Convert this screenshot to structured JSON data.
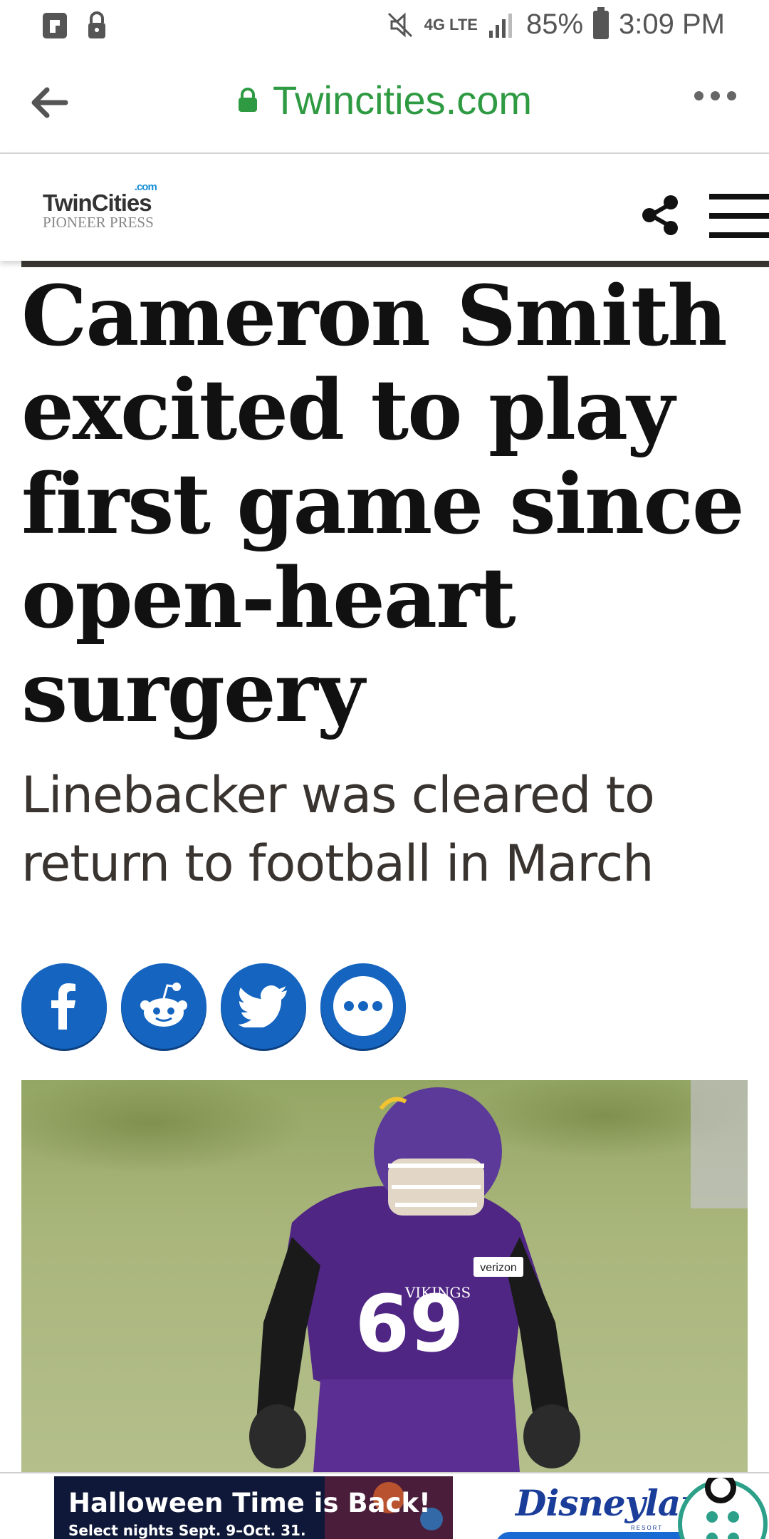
{
  "status_bar": {
    "network": "4G LTE",
    "battery": "85%",
    "time": "3:09 PM"
  },
  "browser": {
    "url": "Twincities.com"
  },
  "site": {
    "logo_main": "TwinCities",
    "logo_com": ".com",
    "logo_sub": "PIONEER PRESS"
  },
  "article": {
    "headline": "Cameron Smith excited to play first game since open-heart surgery",
    "subhead": "Linebacker was cleared to return to football in March"
  },
  "share": {
    "buttons": [
      "facebook",
      "reddit",
      "twitter",
      "more"
    ]
  },
  "hero_image": {
    "jersey_number": "69",
    "team_text": "VIKINGS",
    "sponsor": "verizon"
  },
  "ad": {
    "title": "Halloween Time is Back!",
    "subtitle": "Select nights Sept. 9–Oct. 31.",
    "brand": "Disneyland",
    "brand_sub": "RESORT"
  },
  "colors": {
    "url_green": "#2e9a42",
    "social_blue": "#1565c0",
    "vikings_purple": "#4f2683"
  }
}
